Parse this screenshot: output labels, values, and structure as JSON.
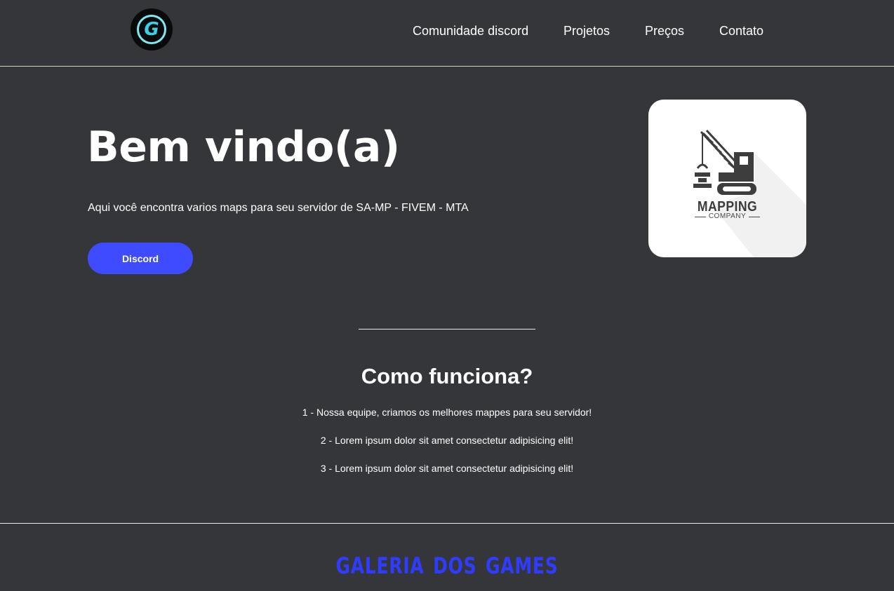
{
  "header": {
    "logo_letter": "G",
    "nav": [
      {
        "label": "Comunidade discord"
      },
      {
        "label": "Projetos"
      },
      {
        "label": "Preços"
      },
      {
        "label": "Contato"
      }
    ]
  },
  "hero": {
    "title": "Bem vindo(a)",
    "text": "Aqui você encontra varios maps para seu servidor de SA-MP - FIVEM - MTA",
    "button_label": "Discord",
    "brand": {
      "name": "MAPPING",
      "sub": "COMPANY",
      "icon": "crane-icon"
    }
  },
  "how": {
    "title": "Como funciona?",
    "steps": [
      "1 - Nossa equipe, criamos os melhores mappes para seu servidor!",
      "2 - Lorem ipsum dolor sit amet consectetur adipisicing elit!",
      "3 - Lorem ipsum dolor sit amet consectetur adipisicing elit!"
    ]
  },
  "gallery": {
    "title": "GALERIA DOS GAMES"
  },
  "colors": {
    "background": "#35363a",
    "accent": "#3f4bff",
    "gallery_title": "#2f3cff",
    "logo_accent": "#3ad0e8"
  }
}
